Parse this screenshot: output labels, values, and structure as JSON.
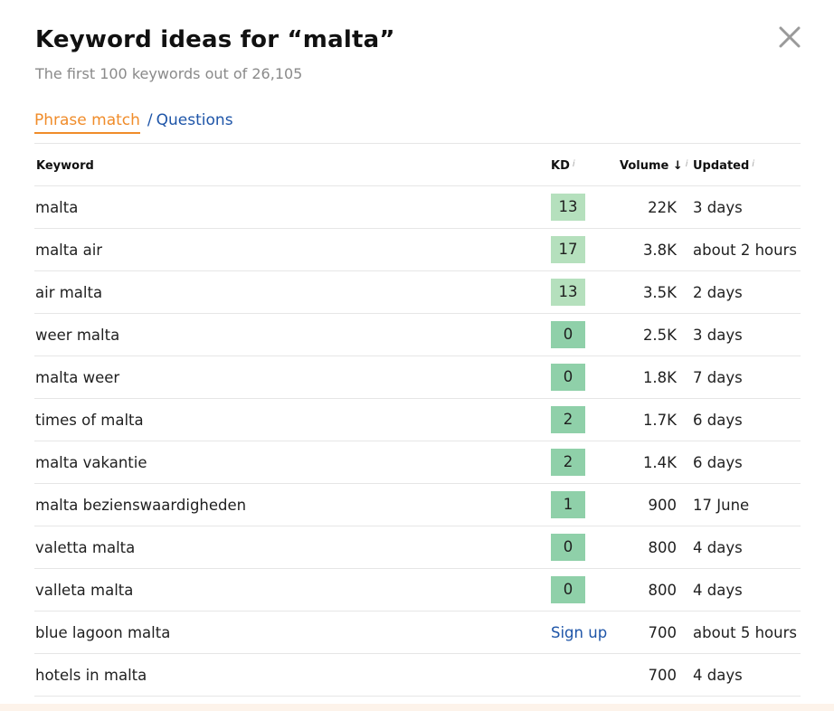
{
  "header": {
    "title": "Keyword ideas for “malta”",
    "subtitle": "The first 100 keywords out of 26,105"
  },
  "close_icon": "close-icon",
  "tabs": {
    "active": "Phrase match",
    "separator": "/",
    "other": "Questions"
  },
  "table": {
    "columns": {
      "keyword": "Keyword",
      "kd": "KD",
      "kd_info": "i",
      "volume": "Volume",
      "volume_sort_icon": "arrow-down-icon",
      "volume_sort_glyph": "↓",
      "volume_info": "i",
      "updated": "Updated",
      "updated_info": "i"
    },
    "rows": [
      {
        "keyword": "malta",
        "kd": "13",
        "kd_color": "#b5e0bd",
        "volume": "22K",
        "updated": "3 days"
      },
      {
        "keyword": "malta air",
        "kd": "17",
        "kd_color": "#b5e0bd",
        "volume": "3.8K",
        "updated": "about 2 hours"
      },
      {
        "keyword": "air malta",
        "kd": "13",
        "kd_color": "#b5e0bd",
        "volume": "3.5K",
        "updated": "2 days"
      },
      {
        "keyword": "weer malta",
        "kd": "0",
        "kd_color": "#8fd0a9",
        "volume": "2.5K",
        "updated": "3 days"
      },
      {
        "keyword": "malta weer",
        "kd": "0",
        "kd_color": "#8fd0a9",
        "volume": "1.8K",
        "updated": "7 days"
      },
      {
        "keyword": "times of malta",
        "kd": "2",
        "kd_color": "#8fd0a9",
        "volume": "1.7K",
        "updated": "6 days"
      },
      {
        "keyword": "malta vakantie",
        "kd": "2",
        "kd_color": "#8fd0a9",
        "volume": "1.4K",
        "updated": "6 days"
      },
      {
        "keyword": "malta bezienswaardigheden",
        "kd": "1",
        "kd_color": "#8fd0a9",
        "volume": "900",
        "updated": "17 June"
      },
      {
        "keyword": "valetta malta",
        "kd": "0",
        "kd_color": "#8fd0a9",
        "volume": "800",
        "updated": "4 days"
      },
      {
        "keyword": "valleta malta",
        "kd": "0",
        "kd_color": "#8fd0a9",
        "volume": "800",
        "updated": "4 days"
      },
      {
        "keyword": "blue lagoon malta",
        "kd_link": "Sign up",
        "volume": "700",
        "updated": "about 5 hours"
      },
      {
        "keyword": "hotels in malta",
        "volume": "700",
        "updated": "4 days"
      }
    ]
  },
  "colors": {
    "accent_orange": "#f08c2a",
    "link_blue": "#1e55a8",
    "kd_light_green": "#b5e0bd",
    "kd_green": "#8fd0a9",
    "footer_tint": "#fdf3ea"
  }
}
